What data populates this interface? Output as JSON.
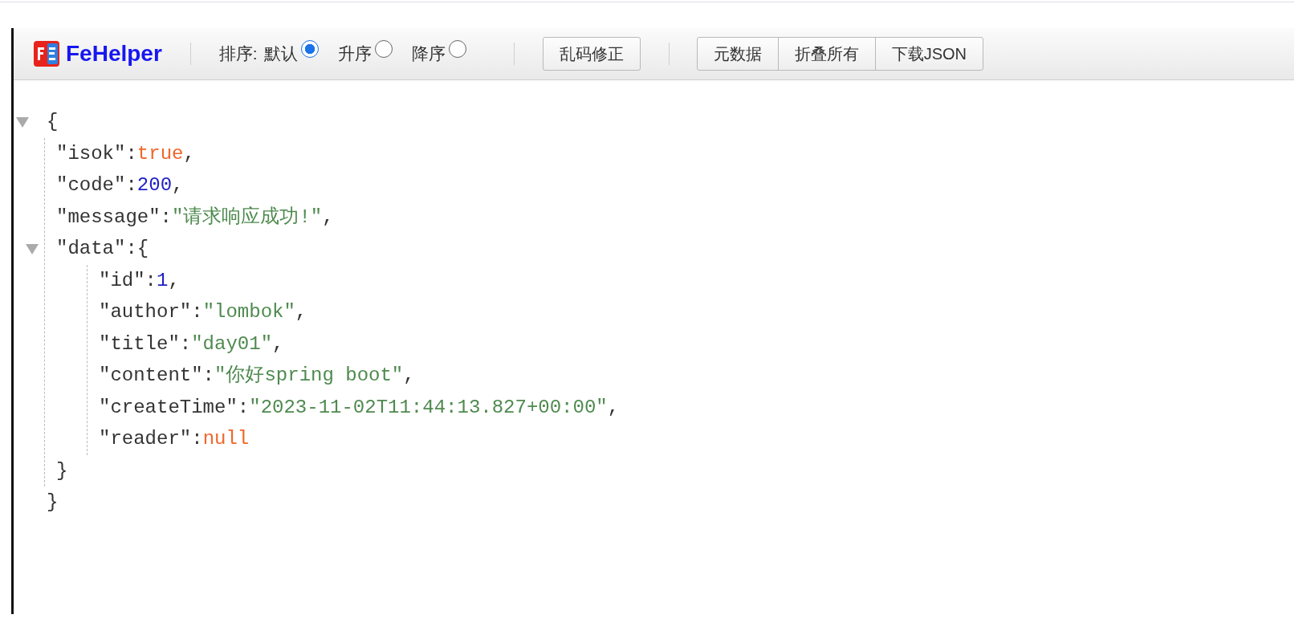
{
  "toolbar": {
    "logo": "FeHelper",
    "sort_label": "排序:",
    "sort_options": [
      {
        "label": "默认",
        "selected": true
      },
      {
        "label": "升序",
        "selected": false
      },
      {
        "label": "降序",
        "selected": false
      }
    ],
    "buttons": [
      "乱码修正"
    ],
    "button_group": [
      "元数据",
      "折叠所有",
      "下载JSON"
    ]
  },
  "json_tree": {
    "expanded": true,
    "open": "{",
    "close": "}",
    "children": [
      {
        "key": "\"isok\":",
        "kind": "boolean",
        "value": "true",
        "separator": ","
      },
      {
        "key": "\"code\":",
        "kind": "number",
        "value": "200",
        "separator": ","
      },
      {
        "key": "\"message\":",
        "kind": "string",
        "value": "\"请求响应成功!\"",
        "separator": ","
      },
      {
        "key": "\"data\":",
        "kind": "object",
        "expanded": true,
        "open": "{",
        "close": "}",
        "children": [
          {
            "key": "\"id\":",
            "kind": "number",
            "value": "1",
            "separator": ","
          },
          {
            "key": "\"author\":",
            "kind": "string",
            "value": "\"lombok\"",
            "separator": ","
          },
          {
            "key": "\"title\":",
            "kind": "string",
            "value": "\"day01\"",
            "separator": ","
          },
          {
            "key": "\"content\":",
            "kind": "string",
            "value": "\"你好spring boot\"",
            "separator": ","
          },
          {
            "key": "\"createTime\":",
            "kind": "string",
            "value": "\"2023-11-02T11:44:13.827+00:00\"",
            "separator": ","
          },
          {
            "key": "\"reader\":",
            "kind": "null",
            "value": "null"
          }
        ]
      }
    ]
  }
}
